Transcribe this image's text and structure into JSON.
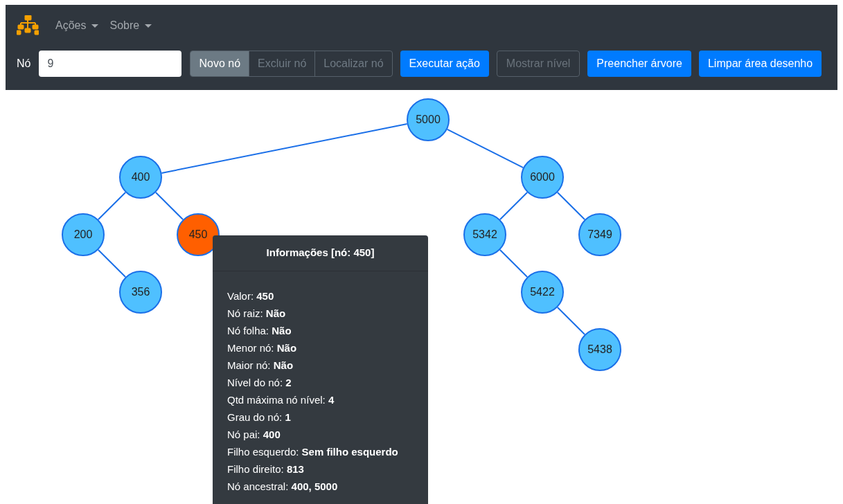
{
  "navbar": {
    "menus": [
      {
        "label": "Ações"
      },
      {
        "label": "Sobre"
      }
    ]
  },
  "toolbar": {
    "field_label": "Nó",
    "field_value": "9",
    "actions": [
      {
        "label": "Novo nó",
        "selected": true
      },
      {
        "label": "Excluir nó",
        "selected": false
      },
      {
        "label": "Localizar nó",
        "selected": false
      }
    ],
    "buttons": [
      {
        "label": "Executar ação",
        "kind": "primary"
      },
      {
        "label": "Mostrar nível",
        "kind": "disabled"
      },
      {
        "label": "Preencher árvore",
        "kind": "primary"
      },
      {
        "label": "Limpar área desenho",
        "kind": "primary"
      }
    ]
  },
  "tree": {
    "value": "5000",
    "selected": false,
    "left": {
      "value": "400",
      "selected": false,
      "left": {
        "value": "200",
        "selected": false,
        "right": {
          "value": "356",
          "selected": false
        }
      },
      "right": {
        "value": "450",
        "selected": true
      }
    },
    "right": {
      "value": "6000",
      "selected": false,
      "left": {
        "value": "5342",
        "selected": false,
        "right": {
          "value": "5422",
          "selected": false,
          "right": {
            "value": "5438",
            "selected": false
          }
        }
      },
      "right": {
        "value": "7349",
        "selected": false
      }
    }
  },
  "tooltip": {
    "title": "Informações [nó: 450]",
    "rows": [
      {
        "label": "Valor:",
        "value": "450"
      },
      {
        "label": "Nó raiz:",
        "value": "Não"
      },
      {
        "label": "Nó folha:",
        "value": "Não"
      },
      {
        "label": "Menor nó:",
        "value": "Não"
      },
      {
        "label": "Maior nó:",
        "value": "Não"
      },
      {
        "label": "Nível do nó:",
        "value": "2"
      },
      {
        "label": "Qtd máxima nó nível:",
        "value": "4"
      },
      {
        "label": "Grau do nó:",
        "value": "1"
      },
      {
        "label": "Nó pai:",
        "value": "400"
      },
      {
        "label": "Filho esquerdo:",
        "value": "Sem filho esquerdo"
      },
      {
        "label": "Filho direito:",
        "value": "813"
      },
      {
        "label": "Nó ancestral:",
        "value": "400, 5000"
      }
    ]
  }
}
